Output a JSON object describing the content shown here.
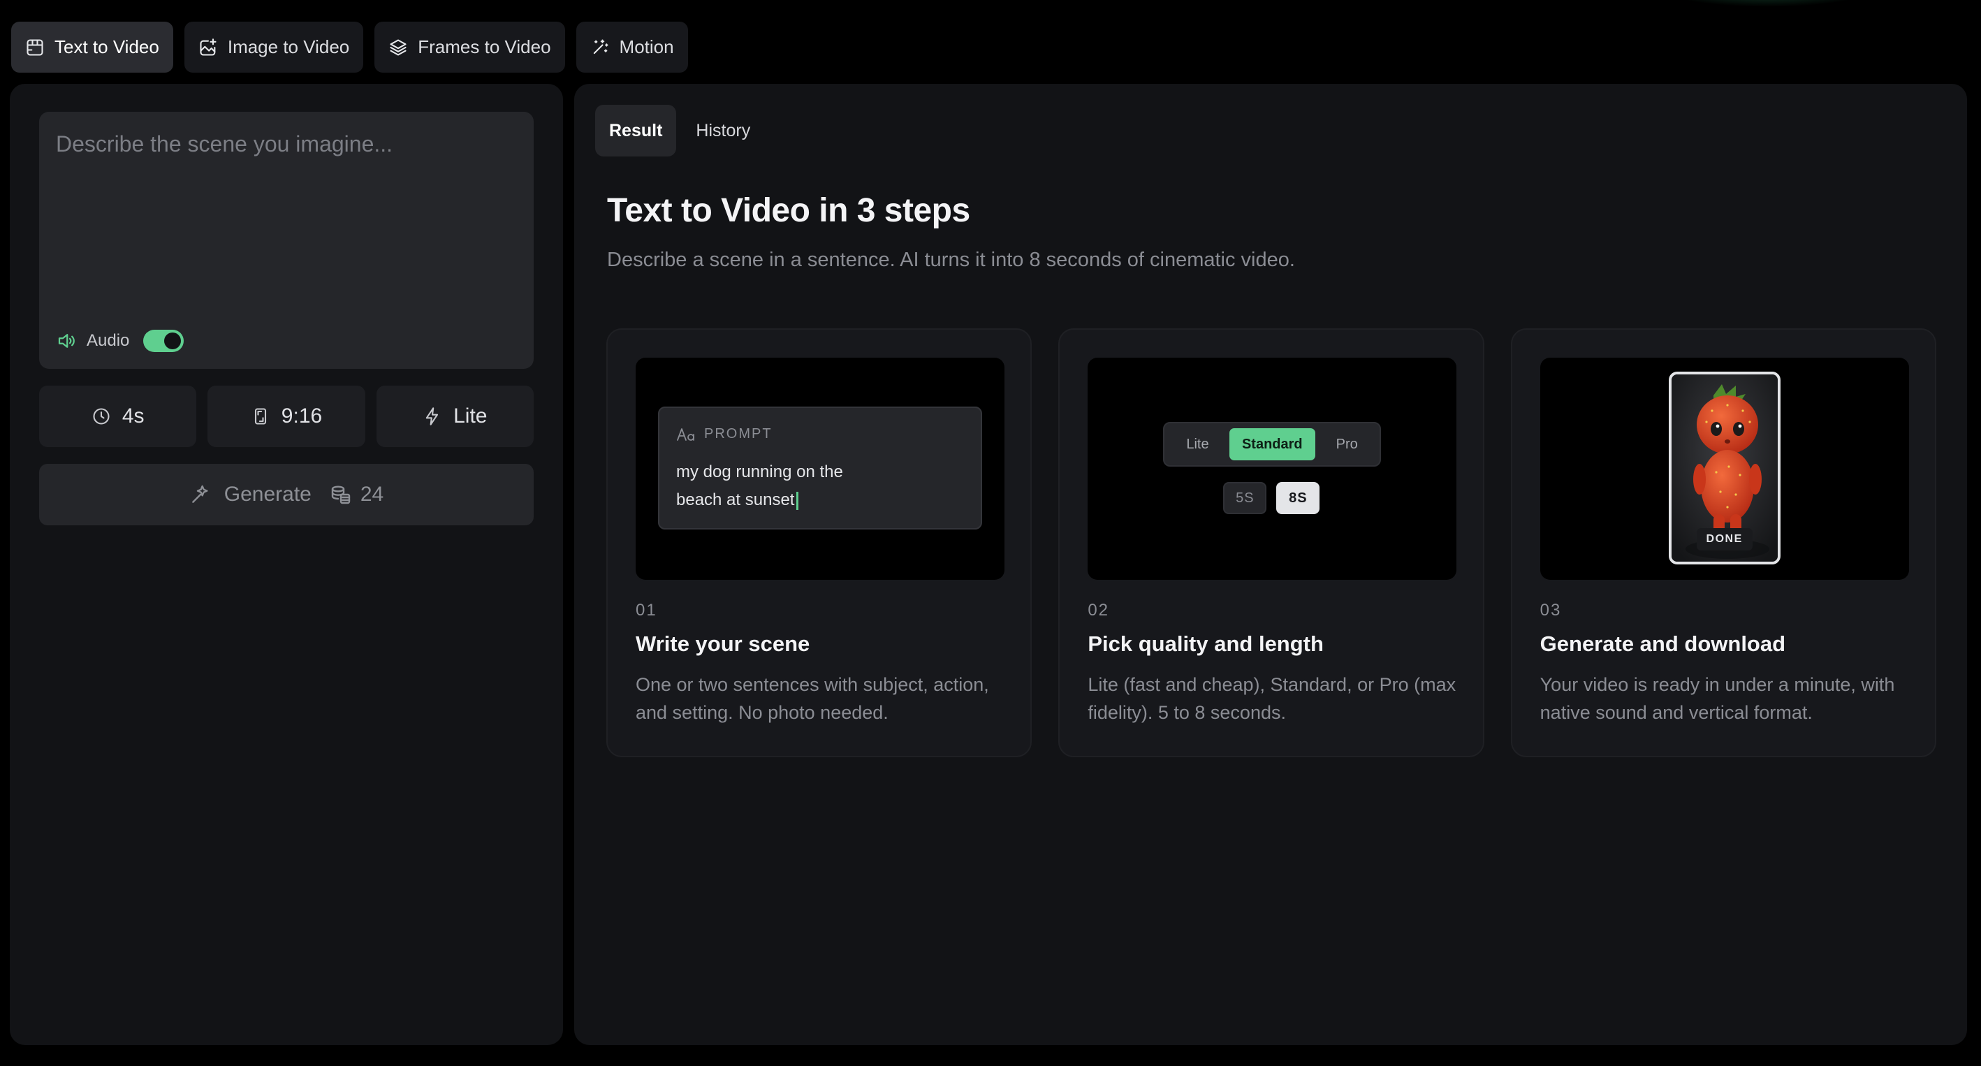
{
  "mode_tabs": [
    {
      "label": "Text to Video",
      "icon": "film-icon",
      "active": true
    },
    {
      "label": "Image to Video",
      "icon": "image-plus-icon",
      "active": false
    },
    {
      "label": "Frames to Video",
      "icon": "layers-icon",
      "active": false
    },
    {
      "label": "Motion",
      "icon": "magic-wand-icon",
      "active": false
    }
  ],
  "composer": {
    "placeholder": "Describe the scene you imagine...",
    "value": "",
    "audio_label": "Audio",
    "audio_enabled": true
  },
  "options": {
    "duration": "4s",
    "aspect_ratio": "9:16",
    "quality": "Lite"
  },
  "generate": {
    "label": "Generate",
    "credits": "24"
  },
  "view_tabs": [
    {
      "label": "Result",
      "active": true
    },
    {
      "label": "History",
      "active": false
    }
  ],
  "intro": {
    "title": "Text to Video in 3 steps",
    "subtitle": "Describe a scene in a sentence. AI turns it into 8 seconds of cinematic video."
  },
  "steps": [
    {
      "num": "01",
      "title": "Write your scene",
      "desc": "One or two sentences with subject, action, and setting. No photo needed.",
      "preview": {
        "label": "PROMPT",
        "text": "my dog running on the beach at sunset"
      }
    },
    {
      "num": "02",
      "title": "Pick quality and length",
      "desc": "Lite (fast and cheap), Standard, or Pro (max fidelity). 5 to 8 seconds.",
      "preview": {
        "qualities": [
          "Lite",
          "Standard",
          "Pro"
        ],
        "selected_quality": "Standard",
        "lengths": [
          "5S",
          "8S"
        ],
        "selected_length": "8S"
      }
    },
    {
      "num": "03",
      "title": "Generate and download",
      "desc": "Your video is ready in under a minute, with native sound and vertical format.",
      "preview": {
        "badge": "DONE"
      }
    }
  ],
  "colors": {
    "accent": "#5fcf8f",
    "background": "#000000",
    "panel": "#121316",
    "card": "#17181c"
  }
}
